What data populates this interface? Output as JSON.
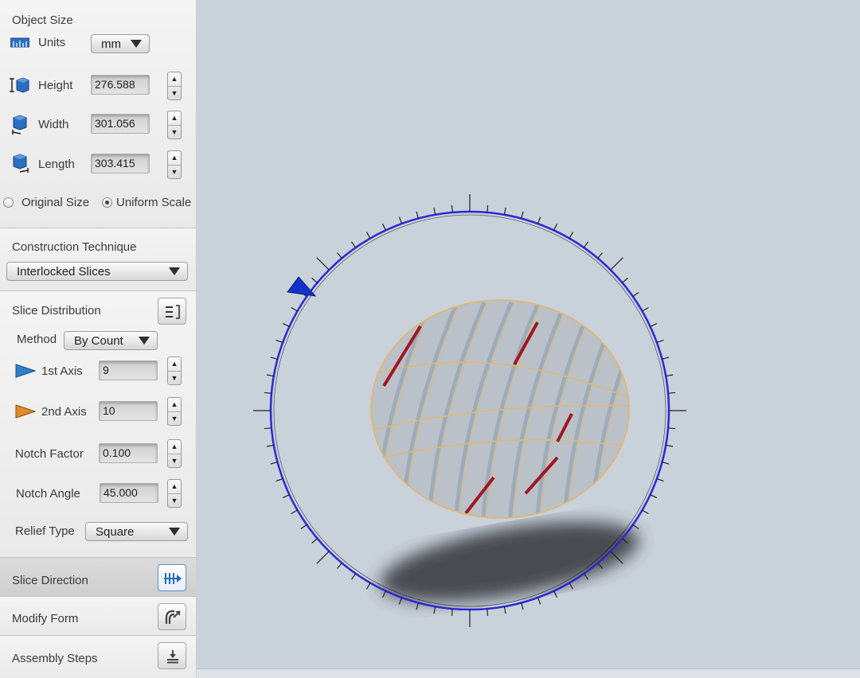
{
  "object_size": {
    "title": "Object Size",
    "units_label": "Units",
    "units_value": "mm",
    "height_label": "Height",
    "height_value": "276.588",
    "width_label": "Width",
    "width_value": "301.056",
    "length_label": "Length",
    "length_value": "303.415",
    "original_size_label": "Original Size",
    "uniform_scale_label": "Uniform Scale",
    "uniform_scale_selected": true
  },
  "construction": {
    "title": "Construction Technique",
    "technique_value": "Interlocked Slices"
  },
  "slice_distribution": {
    "title": "Slice Distribution",
    "method_label": "Method",
    "method_value": "By Count",
    "axis1_label": "1st Axis",
    "axis1_value": "9",
    "axis2_label": "2nd Axis",
    "axis2_value": "10",
    "notch_factor_label": "Notch Factor",
    "notch_factor_value": "0.100",
    "notch_angle_label": "Notch Angle",
    "notch_angle_value": "45.000",
    "relief_type_label": "Relief Type",
    "relief_type_value": "Square"
  },
  "steps": {
    "slice_direction": "Slice Direction",
    "modify_form": "Modify Form",
    "assembly_steps": "Assembly Steps"
  },
  "colors": {
    "ring": "#2a2ad6",
    "axis1_triangle": "#2f7fc9",
    "axis2_triangle": "#e08a2a",
    "slice_fill": "#b9bec6",
    "slice_edge": "#e0b870",
    "slice_red": "#a01820",
    "shadow": "#3a3d42",
    "viewport_bg": "#c9d1db"
  },
  "icons": {
    "units": "ruler-icon",
    "height": "height-cube-icon",
    "width": "width-cube-icon",
    "length": "length-cube-icon",
    "slice_distribution": "distribution-list-icon",
    "slice_direction": "slice-direction-icon",
    "modify_form": "modify-form-icon",
    "assembly_steps": "assembly-steps-icon"
  }
}
